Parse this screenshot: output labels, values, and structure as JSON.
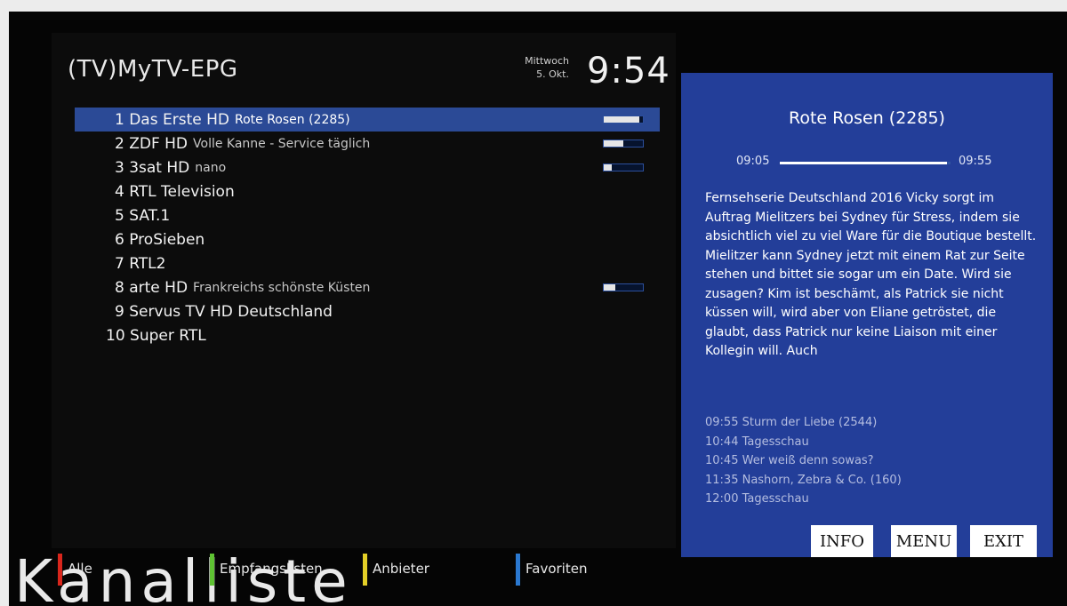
{
  "header": {
    "title": "(TV)MyTV-EPG",
    "weekday": "Mittwoch",
    "date": "5. Okt.",
    "time": "9:54"
  },
  "channels": [
    {
      "name": "1 Das Erste HD",
      "program": "Rote Rosen (2285)",
      "progress": 0.92,
      "selected": true
    },
    {
      "name": "2 ZDF HD",
      "program": "Volle Kanne - Service täglich",
      "progress": 0.5
    },
    {
      "name": "3 3sat HD",
      "program": "nano",
      "progress": 0.2
    },
    {
      "name": "4 RTL Television",
      "program": ""
    },
    {
      "name": "5 SAT.1",
      "program": ""
    },
    {
      "name": "6 ProSieben",
      "program": ""
    },
    {
      "name": "7 RTL2",
      "program": ""
    },
    {
      "name": "8 arte HD",
      "program": "Frankreichs schönste Küsten",
      "progress": 0.3
    },
    {
      "name": "9 Servus TV HD Deutschland",
      "program": ""
    },
    {
      "name": "10 Super RTL",
      "program": ""
    }
  ],
  "detail": {
    "title": "Rote Rosen (2285)",
    "start": "09:05",
    "end": "09:55",
    "progress": 0.98,
    "description": "Fernsehserie Deutschland 2016 Vicky sorgt im Auftrag Mielitzers bei Sydney für Stress, indem sie absichtlich viel zu viel Ware für die Boutique bestellt. Mielitzer kann Sydney jetzt mit einem Rat zur Seite stehen und bittet sie sogar um ein Date. Wird sie zusagen? Kim ist beschämt, als Patrick sie nicht küssen will, wird aber von Eliane getröstet, die glaubt, dass Patrick nur keine Liaison mit einer Kollegin will. Auch",
    "upcoming": [
      "09:55 Sturm der Liebe (2544)",
      "10:44 Tagesschau",
      "10:45 Wer weiß denn sowas?",
      "11:35 Nashorn, Zebra & Co. (160)",
      "12:00 Tagesschau"
    ]
  },
  "buttons": {
    "info": "INFO",
    "menu": "MENU",
    "exit": "EXIT"
  },
  "colorkeys": [
    {
      "label": "Alle",
      "color": "#d9261c"
    },
    {
      "label": "Empfangslisten",
      "color": "#5ec232"
    },
    {
      "label": "Anbieter",
      "color": "#e3cf27"
    },
    {
      "label": "Favoriten",
      "color": "#2a78d0"
    }
  ],
  "background_text": "Kanalliste"
}
